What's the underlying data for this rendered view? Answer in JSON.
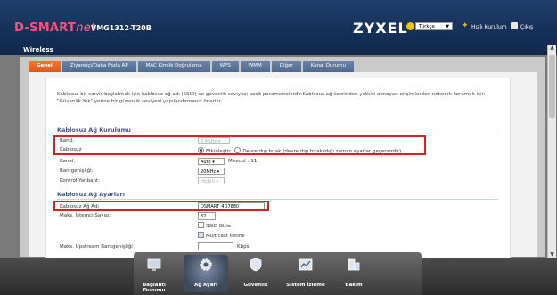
{
  "header": {
    "brand": "D-SMART",
    "brand_net": "net",
    "model": "VMG1312-T20B",
    "vendor": "ZYXEL",
    "language": "Türkçe",
    "wizard": "Hızlı Kurulum",
    "logout": "Çıkış",
    "section": "Wireless"
  },
  "tabs": [
    "Genel",
    "Ziyaretçi/Daha Fazla AP",
    "MAC Kimlik Doğrulama",
    "WPS",
    "WMM",
    "Diğer",
    "Kanal Durumu"
  ],
  "active_tab": "Genel",
  "description": "Kablosuz bir servis başlatmak için kablosuz ağ adı (SSID) ve güvenlik seviyesi basit parametrelerdir.Kablosuz ağ üzerinden yetkisi olmayan erişimlerden network korumak için \"Güvenlik Yok\" yerine bir güvenlik seviyesi yapılandırmanız önerilir.",
  "setup": {
    "title": "Kablosuz Ağ Kurulumu",
    "band_label": "Band:",
    "band_value": "2.4GHz",
    "wireless_label": "Kablosuz",
    "enable_label": "Etkinleştir",
    "disable_label": "Devre dışı bırak (devre dışı bırakıldığı zaman ayarlar geçersizdir)",
    "channel_label": "Kanal:",
    "channel_value": "Auto",
    "channel_current": "Mevcut : 11",
    "bandwidth_label": "Bantgenişliği:",
    "bandwidth_value": "20MHz",
    "sideband_label": "Kontrol Yanbant:",
    "sideband_value": "Hiçbiri"
  },
  "settings": {
    "title": "Kablosuz Ağ Ayarları",
    "ssid_label": "Kablosuz Ağ Adı",
    "ssid_value": "DSMART_4D7880",
    "max_clients_label": "Maks. İstemci Sayısı:",
    "max_clients_value": "32",
    "hide_ssid_label": "SSID Gizle",
    "multicast_label": "Multicast İletimi",
    "upstream_label": "Maks. Upstream Bantgenişliği",
    "upstream_unit": "Kbps"
  },
  "dock": [
    "Bağlantı Durumu",
    "Ağ Ayarı",
    "Güvenlik",
    "Sistem İzleme",
    "Bakım"
  ],
  "colors": {
    "accent": "#e0561c",
    "header": "#163159",
    "highlight": "#d81f26"
  }
}
